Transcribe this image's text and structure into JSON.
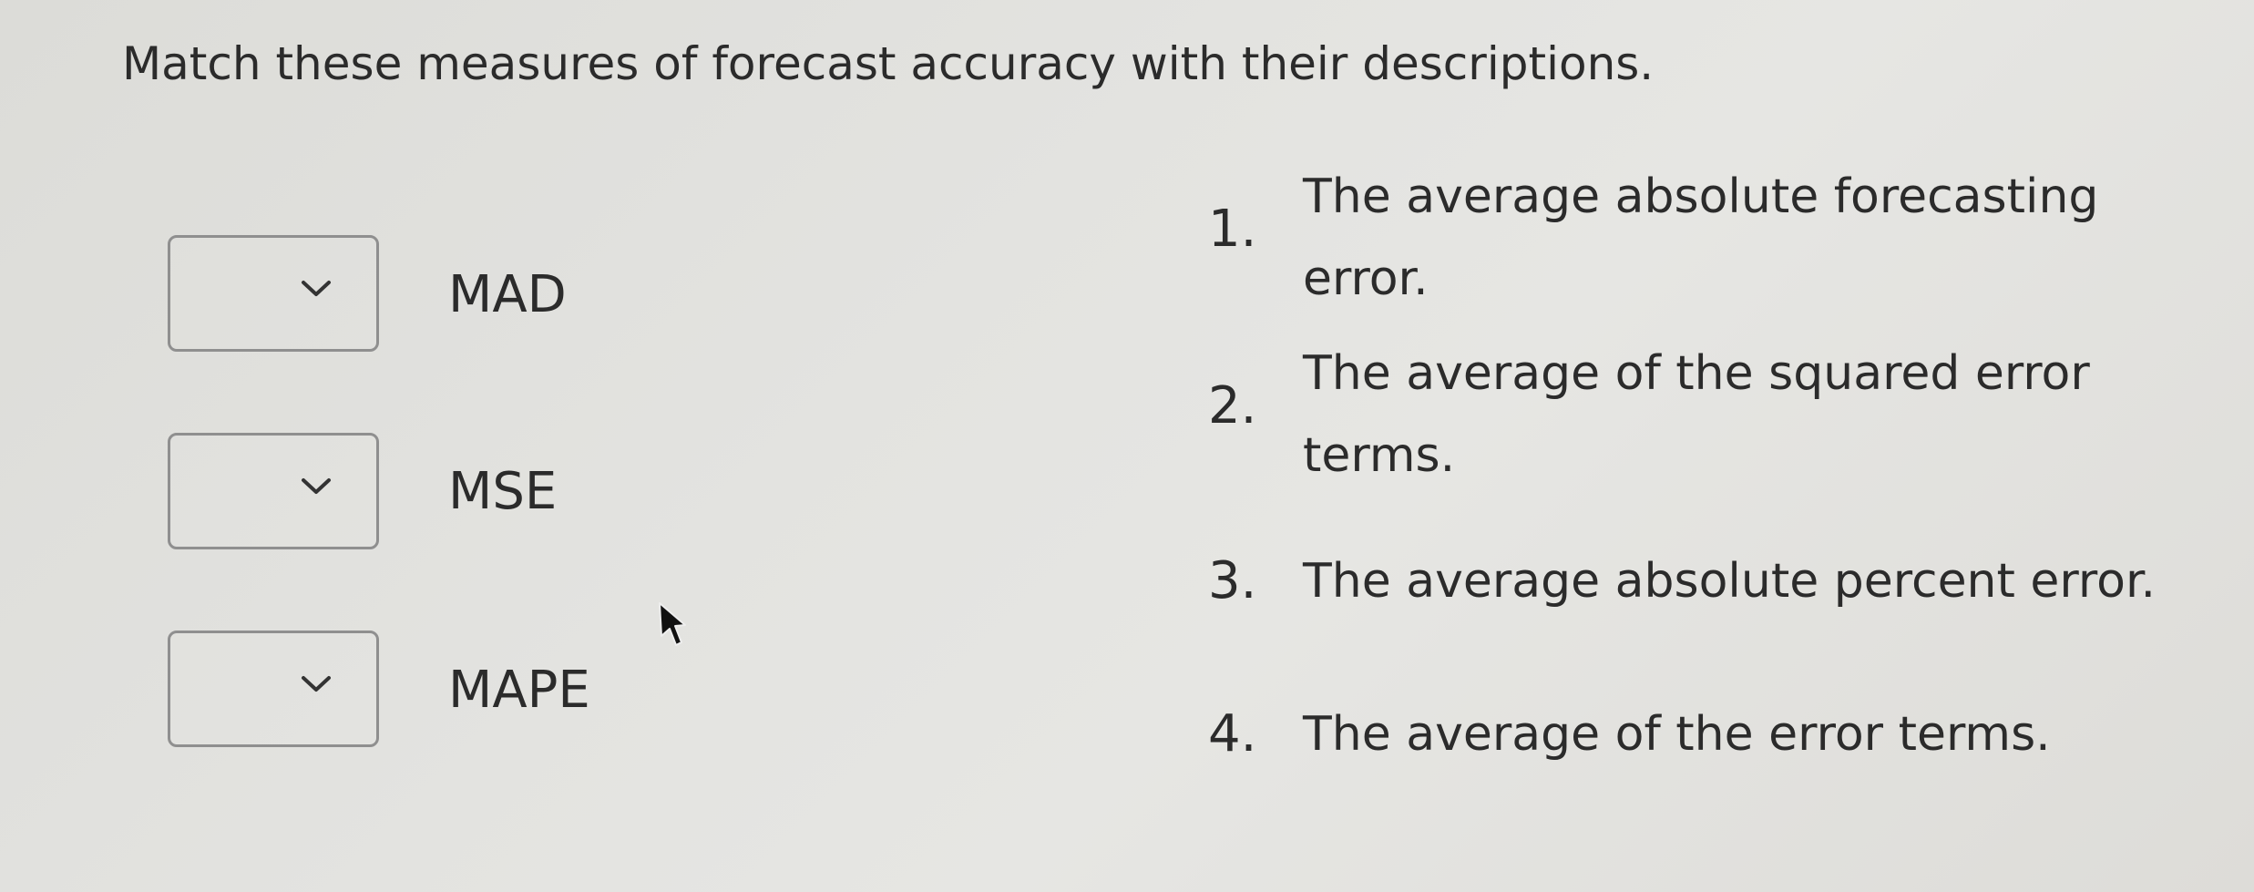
{
  "question": "Match these measures of forecast accuracy with their descriptions.",
  "items": [
    {
      "term": "MAD",
      "selected": ""
    },
    {
      "term": "MSE",
      "selected": ""
    },
    {
      "term": "MAPE",
      "selected": ""
    }
  ],
  "descriptions": [
    {
      "number": "1.",
      "line1": "The average absolute forecasting",
      "line2": "error."
    },
    {
      "number": "2.",
      "line1": "The average of the squared error",
      "line2": "terms."
    },
    {
      "number": "3.",
      "line1": "The average absolute percent error.",
      "line2": ""
    },
    {
      "number": "4.",
      "line1": "The average of the error terms.",
      "line2": ""
    }
  ],
  "icons": {
    "dropdown": "chevron-down-icon",
    "cursor": "mouse-pointer-icon"
  }
}
